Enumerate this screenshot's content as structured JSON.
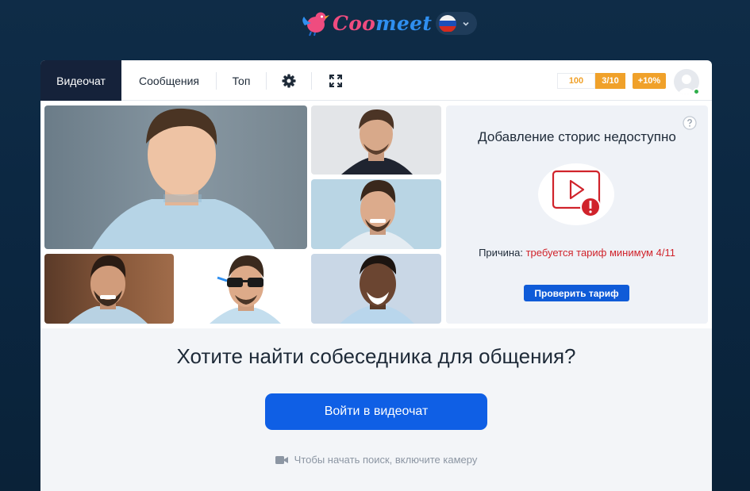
{
  "brand": {
    "logo_text_a": "Coo",
    "logo_text_b": "meet",
    "logo_text_c": "",
    "language_flag": "russia-flag-icon"
  },
  "nav": {
    "tabs": [
      {
        "label": "Видеочат",
        "active": true
      },
      {
        "label": "Сообщения",
        "active": false
      },
      {
        "label": "Топ",
        "active": false
      }
    ],
    "settings_icon": "gear-icon",
    "fullscreen_icon": "expand-icon",
    "coins": "100",
    "level": "3/10",
    "bonus": "+10%"
  },
  "stories": {
    "title": "Добавление сторис недоступно",
    "reason_label": "Причина:",
    "reason_text": "требуется тариф минимум 4/11",
    "button": "Проверить тариф"
  },
  "main": {
    "headline": "Хотите найти собеседника для общения?",
    "enter_button": "Войти в видеочат",
    "camera_hint": "Чтобы начать поиск, включите камеру"
  },
  "colors": {
    "accent": "#0f5fe5",
    "brand_pink": "#ef4c7f",
    "brand_blue": "#2f8ff0",
    "badge_orange": "#f0a12a",
    "active_tab": "#15223a",
    "error_red": "#d0232b"
  }
}
